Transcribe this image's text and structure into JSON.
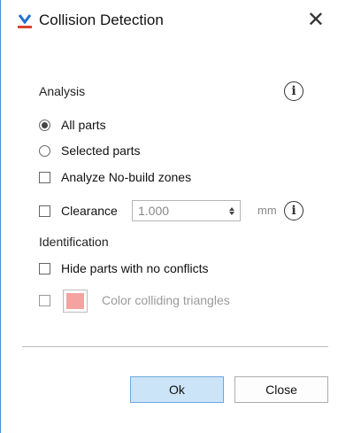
{
  "dialog": {
    "title": "Collision Detection",
    "close_glyph": "✕",
    "app_icon": "collision-app-icon"
  },
  "analysis": {
    "label": "Analysis",
    "info_icon": "info-icon",
    "info_glyph": "i",
    "options": [
      {
        "label": "All parts",
        "selected": true
      },
      {
        "label": "Selected parts",
        "selected": false
      }
    ],
    "analyze_no_build": {
      "label": "Analyze No-build zones",
      "checked": false
    },
    "clearance": {
      "label": "Clearance",
      "checked": false,
      "value": "1.000",
      "unit": "mm",
      "info_glyph": "i"
    }
  },
  "identification": {
    "label": "Identification",
    "hide_parts": {
      "label": "Hide parts with no conflicts",
      "checked": false
    },
    "color_triangles": {
      "label": "Color colliding triangles",
      "checked": false,
      "swatch_color": "#f4a3a0",
      "enabled": false
    }
  },
  "buttons": {
    "ok": "Ok",
    "close": "Close"
  },
  "colors": {
    "accent": "#4a90d9",
    "primary_button_bg": "#cce4f7",
    "swatch": "#f4a3a0"
  }
}
